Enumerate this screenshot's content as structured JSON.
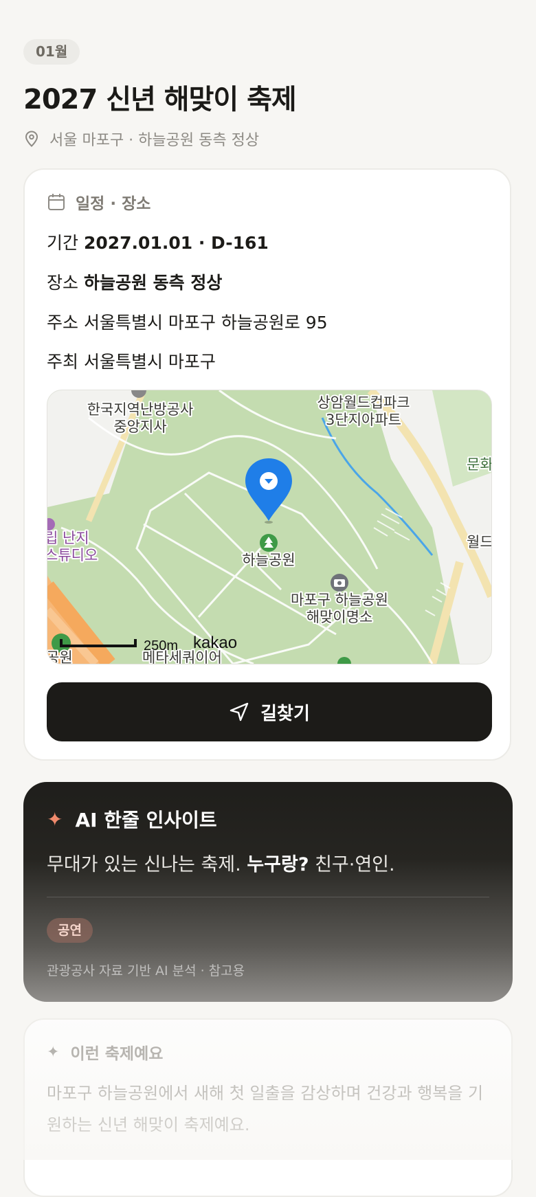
{
  "header": {
    "month_badge": "01월",
    "title": "2027 신년 해맞이 축제",
    "location_line": "서울 마포구 · 하늘공원 동측 정상",
    "location_icon": "map-pin-icon"
  },
  "info_card": {
    "heading": "일정 · 장소",
    "heading_icon": "calendar-icon",
    "rows": [
      {
        "label": "기간",
        "value": "2027.01.01 · D-161"
      },
      {
        "label": "장소",
        "value": "하늘공원 동측 정상"
      },
      {
        "label": "주소",
        "value": "서울특별시 마포구 하늘공원로 95"
      },
      {
        "label": "주최",
        "value": "서울특별시 마포구"
      }
    ],
    "map": {
      "labels": {
        "heating": "한국지역난방공사",
        "heating2": "중앙지사",
        "worldcup1": "상암월드컵파크",
        "worldcup2": "3단지아파트",
        "culture": "문화",
        "studio1": "립 난지",
        "studio2": "스튜디오",
        "world": "월드",
        "haneul": "하늘공원",
        "sunrise1": "마포구 하늘공원",
        "sunrise2": "해맞이명소",
        "metasequoia": "메타세쿼이어",
        "bottom_left": "공원"
      },
      "scale": "250m",
      "brand": "kakao"
    },
    "route_button": "길찾기"
  },
  "ai_card": {
    "heading": "AI 한줄 인사이트",
    "text_prefix": "무대가 있는 신나는 축제. ",
    "text_bold": "누구랑?",
    "text_suffix": " 친구·연인.",
    "tag": "공연",
    "note": "관광공사 자료 기반 AI 분석 · 참고용"
  },
  "about_card": {
    "heading": "이런 축제예요",
    "body": "마포구 하늘공원에서 새해 첫 일출을 감상하며 건강과 행복을 기원하는 신년 해맞이 축제예요."
  },
  "colors": {
    "background": "#f7f6f3",
    "button": "#1c1b18",
    "ai_accent": "#f08a6c",
    "map_park": "#c4dcb0",
    "pin": "#1f7ee8"
  }
}
